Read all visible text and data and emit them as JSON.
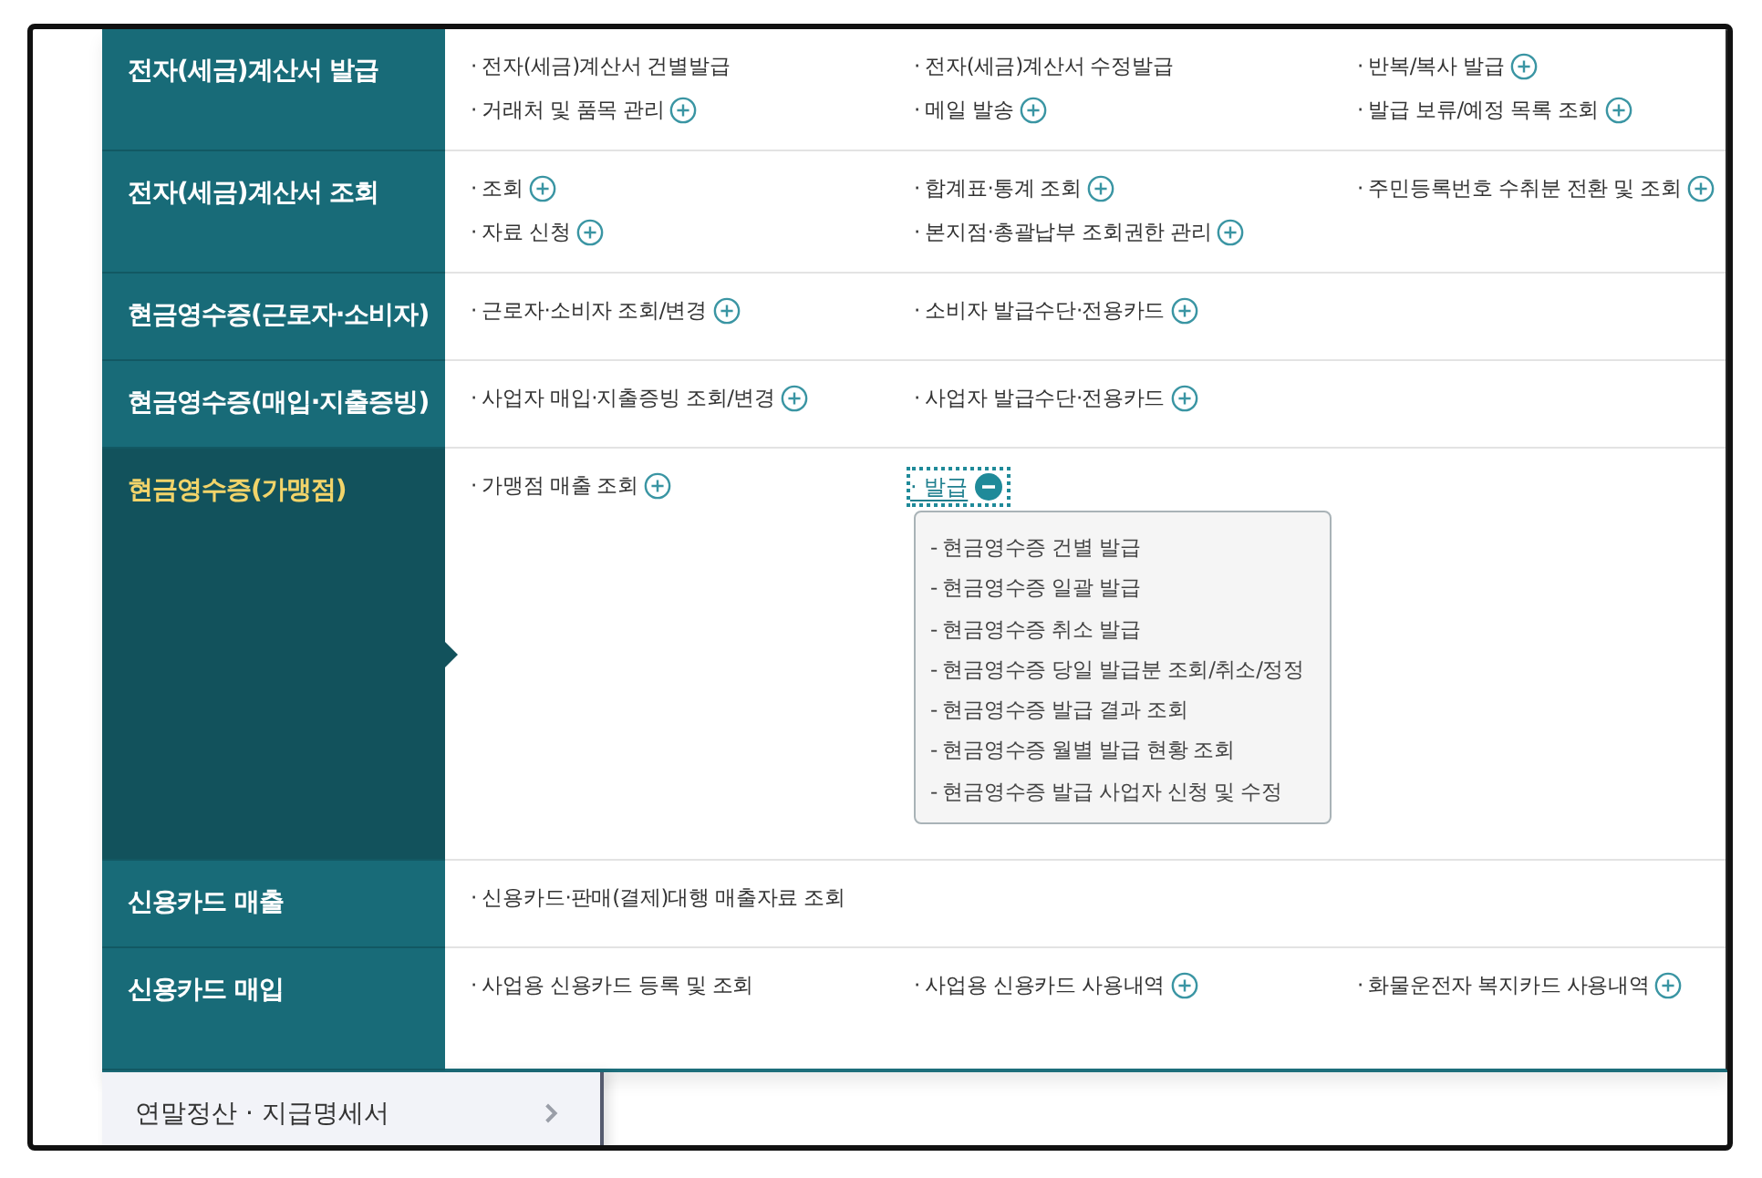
{
  "menu": {
    "categories": [
      {
        "title": "전자(세금)계산서 발급",
        "selected": false,
        "items": [
          {
            "text": "· 전자(세금)계산서 건별발급",
            "kind": "link"
          },
          {
            "text": "· 전자(세금)계산서 수정발급",
            "kind": "link"
          },
          {
            "text": "· 반복/복사 발급",
            "kind": "more"
          },
          {
            "text": "· 거래처 및 품목 관리",
            "kind": "more"
          },
          {
            "text": "· 메일 발송",
            "kind": "more"
          },
          {
            "text": "· 발급 보류/예정 목록 조회",
            "kind": "more"
          }
        ]
      },
      {
        "title": "전자(세금)계산서 조회",
        "selected": false,
        "items": [
          {
            "text": "· 조회",
            "kind": "more"
          },
          {
            "text": "· 합계표·통계 조회",
            "kind": "more"
          },
          {
            "text": "· 주민등록번호 수취분 전환 및 조회",
            "kind": "more"
          },
          {
            "text": "· 자료 신청",
            "kind": "more"
          },
          {
            "text": "· 본지점·총괄납부 조회권한 관리",
            "kind": "more"
          }
        ]
      },
      {
        "title": "현금영수증(근로자·소비자)",
        "selected": false,
        "items": [
          {
            "text": "· 근로자·소비자 조회/변경",
            "kind": "more"
          },
          {
            "text": "· 소비자 발급수단·전용카드",
            "kind": "more"
          }
        ]
      },
      {
        "title": "현금영수증(매입·지출증빙)",
        "selected": false,
        "items": [
          {
            "text": "· 사업자 매입·지출증빙 조회/변경",
            "kind": "more"
          },
          {
            "text": "· 사업자 발급수단·전용카드",
            "kind": "more"
          }
        ]
      },
      {
        "title": "현금영수증(가맹점)",
        "selected": true,
        "items": [
          {
            "text": "· 가맹점 매출 조회",
            "kind": "more"
          },
          {
            "text": "· 발급",
            "kind": "toggle",
            "expanded": true,
            "children": [
              "- 현금영수증 건별 발급",
              "- 현금영수증 일괄 발급",
              "- 현금영수증 취소 발급",
              "- 현금영수증 당일 발급분 조회/취소/정정",
              "- 현금영수증 발급 결과 조회",
              "- 현금영수증 월별 발급 현황 조회",
              "- 현금영수증 발급 사업자 신청 및 수정"
            ]
          }
        ]
      },
      {
        "title": "신용카드 매출",
        "selected": false,
        "items": [
          {
            "text": "· 신용카드·판매(결제)대행 매출자료 조회",
            "kind": "link"
          }
        ]
      },
      {
        "title": "신용카드 매입",
        "selected": false,
        "items": [
          {
            "text": "· 사업용 신용카드 등록 및 조회",
            "kind": "link"
          },
          {
            "text": "· 사업용 신용카드 사용내역",
            "kind": "more"
          },
          {
            "text": "· 화물운전자 복지카드 사용내역",
            "kind": "more"
          }
        ]
      }
    ]
  },
  "sidebar": {
    "items": [
      {
        "label": "연말정산 · 지급명세서"
      }
    ]
  }
}
